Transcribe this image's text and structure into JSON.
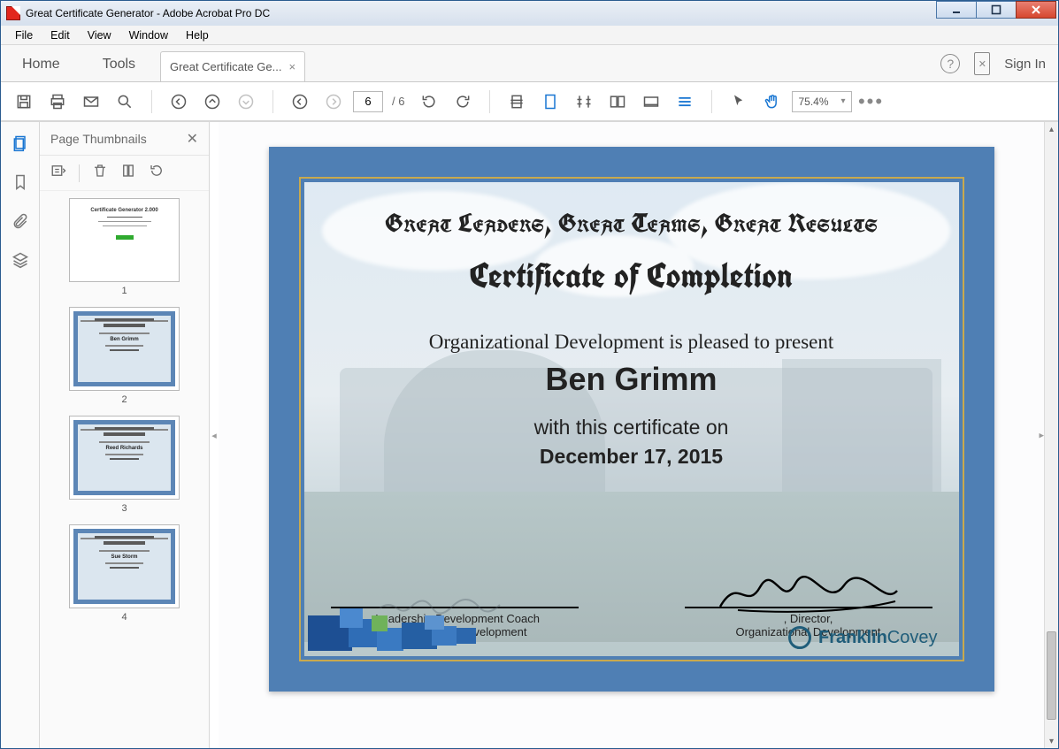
{
  "window": {
    "title": "Great Certificate Generator - Adobe Acrobat Pro DC"
  },
  "menubar": [
    "File",
    "Edit",
    "View",
    "Window",
    "Help"
  ],
  "tabs": {
    "home": "Home",
    "tools": "Tools",
    "doc": "Great Certificate Ge...",
    "signin": "Sign In"
  },
  "toolbar": {
    "page_current": "6",
    "page_total": "/  6",
    "zoom": "75.4%"
  },
  "left_panel": {
    "title": "Page Thumbnails",
    "thumbs": [
      {
        "num": "1",
        "variant": "plain",
        "lines": [
          "Certificate Generator 2.000",
          "",
          "Dec 2015",
          "",
          ""
        ]
      },
      {
        "num": "2",
        "variant": "cert",
        "name": "Ben Grimm"
      },
      {
        "num": "3",
        "variant": "cert",
        "name": "Reed Richards"
      },
      {
        "num": "4",
        "variant": "cert",
        "name": "Sue Storm"
      }
    ]
  },
  "certificate": {
    "headline": "Great Leaders, Great Teams, Great Results",
    "title": "Certificate of Completion",
    "present": "Organizational Development is pleased to present",
    "name": "Ben Grimm",
    "withline": "with this certificate on",
    "date": "December 17, 2015",
    "sig_left_role": ", Leadership Development Coach",
    "sig_left_dept": "Organizational Development",
    "sig_right_role": ", Director,",
    "sig_right_dept": "Organizational Development",
    "logo_a": "Franklin",
    "logo_b": "Covey"
  }
}
